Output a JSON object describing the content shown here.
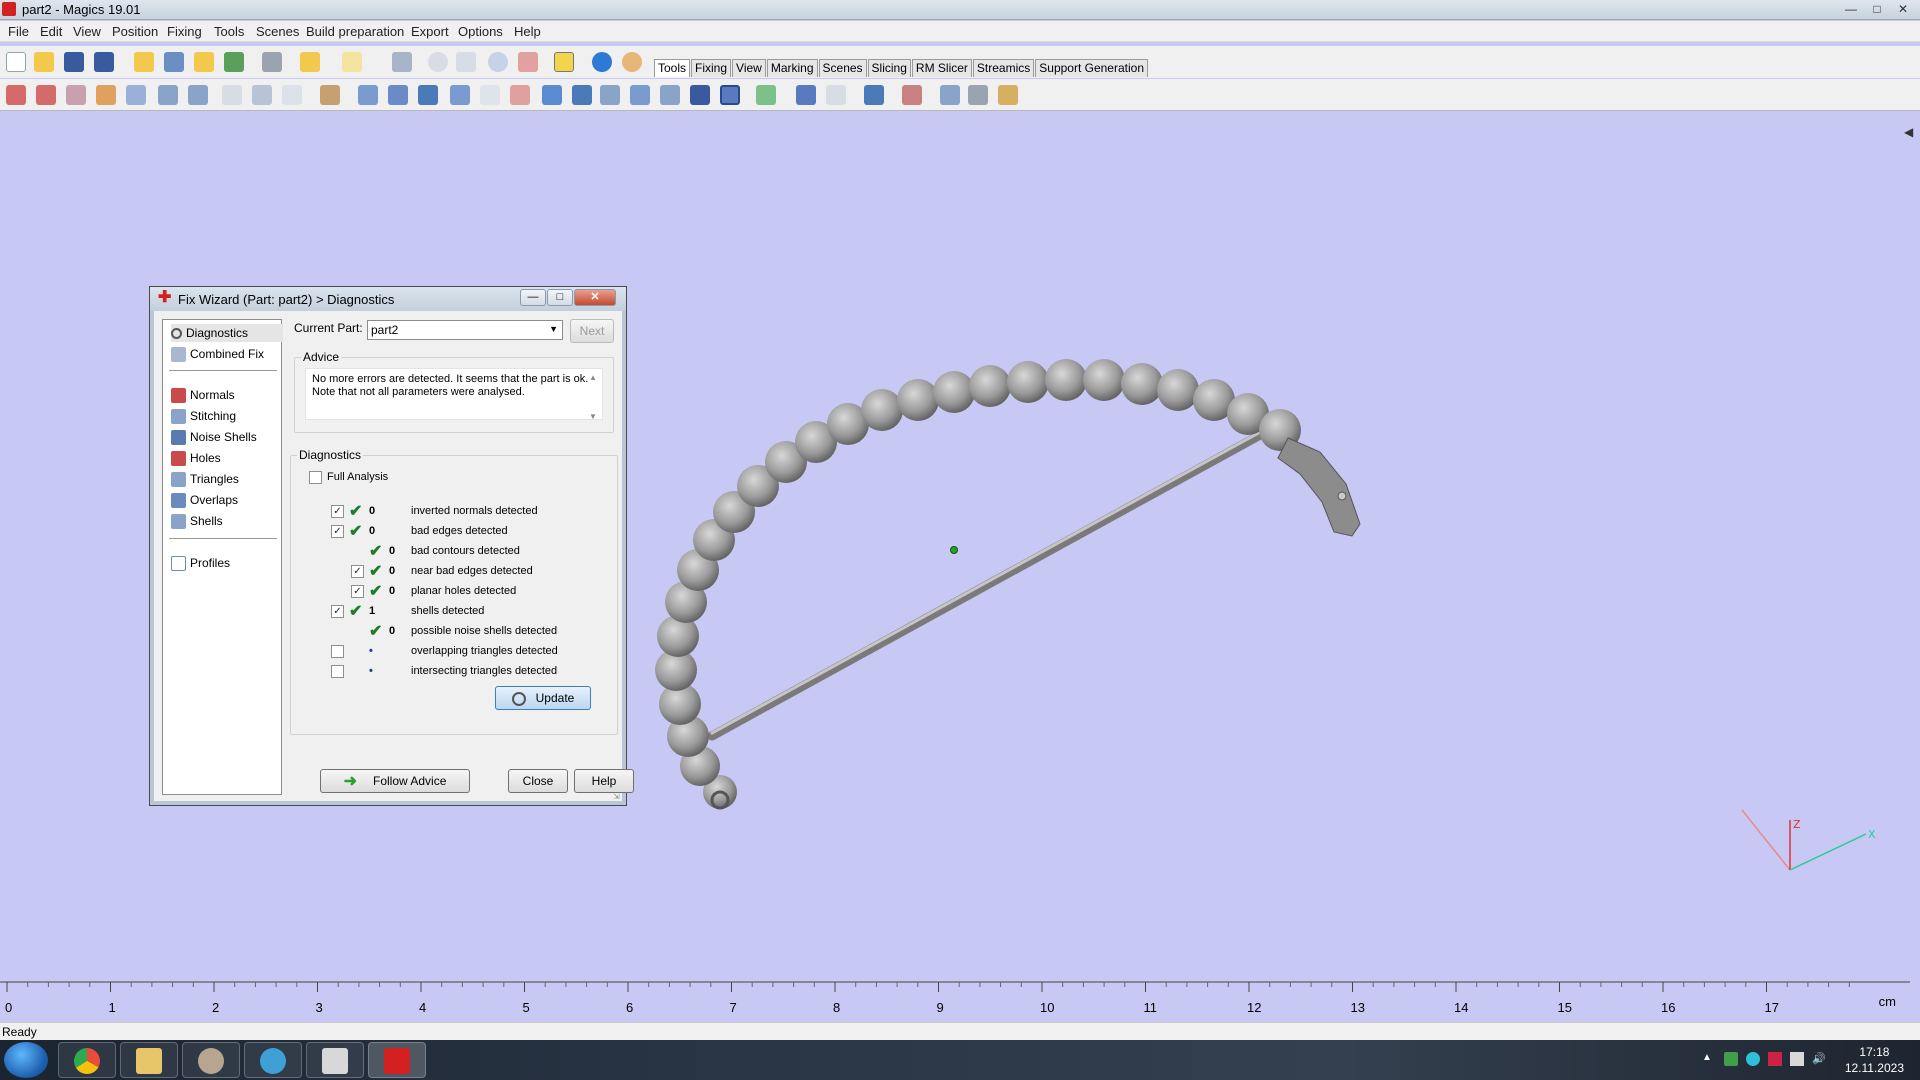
{
  "window": {
    "title": "part2 - Magics 19.01"
  },
  "menu": [
    "File",
    "Edit",
    "View",
    "Position",
    "Fixing",
    "Tools",
    "Scenes",
    "Build preparation",
    "Export",
    "Options",
    "Help"
  ],
  "toolbar_tabs": [
    {
      "label": "Tools",
      "active": true
    },
    {
      "label": "Fixing",
      "active": false
    },
    {
      "label": "View",
      "active": false
    },
    {
      "label": "Marking",
      "active": false
    },
    {
      "label": "Scenes",
      "active": false
    },
    {
      "label": "Slicing",
      "active": false
    },
    {
      "label": "RM Slicer",
      "active": false
    },
    {
      "label": "Streamics",
      "active": false
    },
    {
      "label": "Support Generation",
      "active": false
    }
  ],
  "dialog": {
    "title": "Fix Wizard (Part: part2) > Diagnostics",
    "sidebar": {
      "group1": [
        "Diagnostics",
        "Combined Fix"
      ],
      "group2": [
        "Normals",
        "Stitching",
        "Noise Shells",
        "Holes",
        "Triangles",
        "Overlaps",
        "Shells"
      ],
      "group3": [
        "Profiles"
      ]
    },
    "current_part_label": "Current Part:",
    "current_part_value": "part2",
    "next_label": "Next",
    "advice_legend": "Advice",
    "advice_text": "No more errors are detected. It seems that the part is ok. Note that not all parameters were analysed.",
    "diagnostics_legend": "Diagnostics",
    "full_analysis_label": "Full Analysis",
    "rows": [
      {
        "checked": true,
        "status": "ok",
        "count": "0",
        "label": "inverted normals detected",
        "indent": 0
      },
      {
        "checked": true,
        "status": "ok",
        "count": "0",
        "label": "bad edges detected",
        "indent": 0
      },
      {
        "checked": null,
        "status": "ok",
        "count": "0",
        "label": "bad contours detected",
        "indent": 1
      },
      {
        "checked": true,
        "status": "ok",
        "count": "0",
        "label": "near bad edges detected",
        "indent": 1
      },
      {
        "checked": true,
        "status": "ok",
        "count": "0",
        "label": "planar holes detected",
        "indent": 1
      },
      {
        "checked": true,
        "status": "ok",
        "count": "1",
        "label": "shells detected",
        "indent": 0
      },
      {
        "checked": null,
        "status": "ok",
        "count": "0",
        "label": "possible noise shells detected",
        "indent": 1
      },
      {
        "checked": false,
        "status": "none",
        "count": "•",
        "label": "overlapping triangles detected",
        "indent": 0
      },
      {
        "checked": false,
        "status": "none",
        "count": "•",
        "label": "intersecting triangles detected",
        "indent": 0
      }
    ],
    "update_label": "Update",
    "follow_advice_label": "Follow Advice",
    "close_label": "Close",
    "help_label": "Help"
  },
  "ruler": {
    "ticks": [
      "0",
      "1",
      "2",
      "3",
      "4",
      "5",
      "6",
      "7",
      "8",
      "9",
      "10",
      "11",
      "12",
      "13",
      "14",
      "15",
      "16",
      "17"
    ],
    "unit": "cm"
  },
  "axis_labels": {
    "z": "Z",
    "x": "X"
  },
  "status": "Ready",
  "clock": {
    "time": "17:18",
    "date": "12.11.2023"
  },
  "colors": {
    "viewport": "#c8c8f4",
    "ok_check": "#1c7d2b",
    "model": "#8f8f8f"
  }
}
